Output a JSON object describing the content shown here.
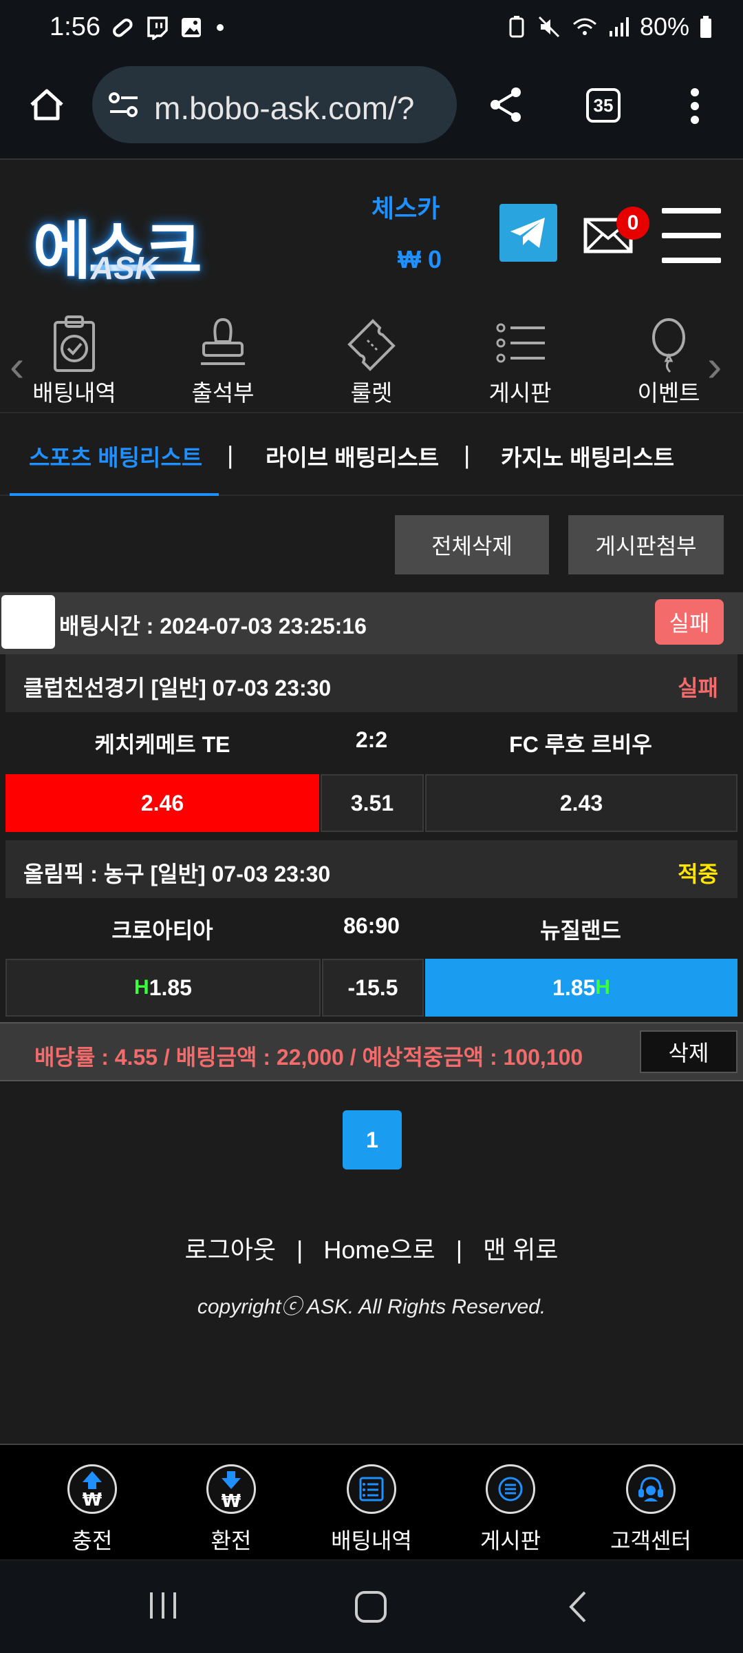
{
  "status_bar": {
    "time": "1:56",
    "battery": "80%"
  },
  "browser": {
    "url": "m.bobo-ask.com/?",
    "tab_count": "35"
  },
  "header": {
    "logo_text": "에스크",
    "logo_sub": "ASK",
    "username": "체스카",
    "balance": "₩ 0",
    "message_count": "0"
  },
  "icon_nav": [
    {
      "label": "배팅내역",
      "icon": "clipboard-check-icon"
    },
    {
      "label": "출석부",
      "icon": "stamp-icon"
    },
    {
      "label": "룰렛",
      "icon": "ticket-icon"
    },
    {
      "label": "게시판",
      "icon": "list-icon"
    },
    {
      "label": "이벤트",
      "icon": "balloon-icon"
    }
  ],
  "tabs": {
    "sports": "스포츠 배팅리스트",
    "live": "라이브 배팅리스트",
    "casino": "카지노 배팅리스트",
    "sep": "|"
  },
  "actions": {
    "delete_all": "전체삭제",
    "attach_board": "게시판첨부"
  },
  "bet": {
    "time_label": "배팅시간 : 2024-07-03 23:25:16",
    "status": "실패",
    "games": [
      {
        "title": "클럽친선경기  [일반]  07-03 23:30",
        "result": "실패",
        "home": "케치케메트 TE",
        "score": "2:2",
        "away": "FC 루흐 르비우",
        "odd_home": "2.46",
        "odd_mid": "3.51",
        "odd_away": "2.43"
      },
      {
        "title": "올림픽 : 농구  [일반]  07-03 23:30",
        "result": "적중",
        "home": "크로아티아",
        "score": "86:90",
        "away": "뉴질랜드",
        "odd_home": "1.85",
        "odd_mid": "-15.5",
        "odd_away": "1.85",
        "handicap_mark": "H"
      }
    ],
    "summary": "배당률 : 4.55 / 배팅금액 : 22,000 / 예상적중금액 : 100,100",
    "delete": "삭제"
  },
  "pagination": {
    "current": "1"
  },
  "footer": {
    "logout": "로그아웃",
    "home": "Home으로",
    "top": "맨 위로",
    "sep": "|",
    "copyright": "copyrightⓒ ASK. All Rights Reserved."
  },
  "bottom_nav": [
    {
      "label": "충전"
    },
    {
      "label": "환전"
    },
    {
      "label": "배팅내역"
    },
    {
      "label": "게시판"
    },
    {
      "label": "고객센터"
    }
  ],
  "colors": {
    "accent_blue": "#1e90ff",
    "fail_red": "#f36b6b",
    "hit_yellow": "#ffe600",
    "selected_red": "#ff0000",
    "selected_blue": "#1a9cf0"
  }
}
